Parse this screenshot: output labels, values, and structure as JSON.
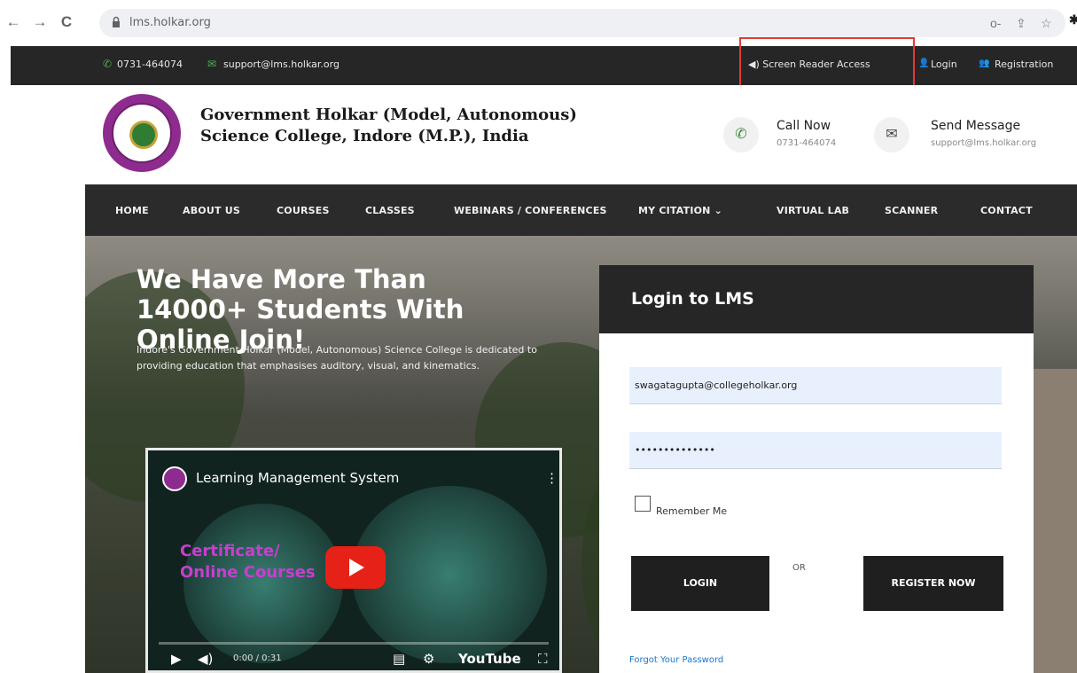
{
  "browser": {
    "url": "lms.holkar.org",
    "back_glyph": "←",
    "forward_glyph": "→",
    "reload_glyph": "C",
    "key_glyph": "o-",
    "share_glyph": "⇪",
    "star_glyph": "☆",
    "edge_glyph": "✱"
  },
  "topbar": {
    "phone": "0731-464074",
    "email": "support@lms.holkar.org",
    "screen_reader": "◀) Screen Reader Access",
    "login": "Login",
    "registration": "Registration",
    "highlight_color": "#e53935"
  },
  "header": {
    "college_line1": "Government Holkar (Model, Autonomous)",
    "college_line2": "Science College, Indore (M.P.), India",
    "call_title": "Call Now",
    "call_number": "0731-464074",
    "message_title": "Send Message",
    "message_email": "support@lms.holkar.org"
  },
  "nav": {
    "items": [
      "HOME",
      "ABOUT US",
      "COURSES",
      "CLASSES",
      "WEBINARS / CONFERENCES",
      "MY CITATION ⌄",
      "VIRTUAL LAB",
      "SCANNER",
      "CONTACT"
    ]
  },
  "hero": {
    "heading": "We Have More Than 14000+ Students With Online Join!",
    "paragraph": "Indore's Government Holkar (Model, Autonomous) Science College is dedicated to providing education that emphasises auditory, visual, and kinematics."
  },
  "video": {
    "title": "Learning Management System",
    "promo_line1": "Certificate/",
    "promo_line2": "Online Courses",
    "time": "0:00 / 0:31",
    "youtube": "YouTube",
    "play_glyph": "▶",
    "volume_glyph": "◀)",
    "kebab_glyph": "⋮",
    "cc_glyph": "▤",
    "settings_glyph": "⚙",
    "fullscreen_glyph": "⛶"
  },
  "login": {
    "heading": "Login to LMS",
    "email_value": "swagatagupta@collegeholkar.org",
    "password_value": "••••••••••••••",
    "remember": "Remember Me",
    "login_button": "LOGIN",
    "or": "OR",
    "register_button": "REGISTER NOW",
    "forgot": "Forgot Your Password"
  },
  "icons": {
    "phone": "✆",
    "mail": "✉",
    "user": "👤",
    "add_user": "👥"
  }
}
